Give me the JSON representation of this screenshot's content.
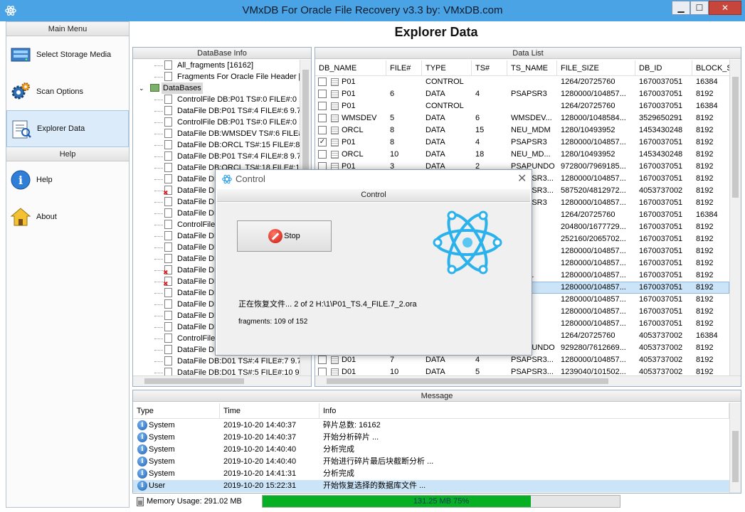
{
  "window": {
    "title": "VMxDB For Oracle File Recovery v3.3 by: VMxDB.com"
  },
  "sidebar": {
    "main_menu_header": "Main Menu",
    "help_header": "Help",
    "items": [
      {
        "label": "Select Storage Media",
        "icon": "storage-media-icon"
      },
      {
        "label": "Scan Options",
        "icon": "gear-icon"
      },
      {
        "label": "Explorer Data",
        "icon": "explorer-data-icon",
        "active": true
      }
    ],
    "help_items": [
      {
        "label": "Help",
        "icon": "info-icon"
      },
      {
        "label": "About",
        "icon": "house-icon"
      }
    ]
  },
  "main": {
    "title": "Explorer Data"
  },
  "dbinfo": {
    "header": "DataBase Info",
    "tree": [
      {
        "label": "All_fragments [16162]",
        "level": 2
      },
      {
        "label": "Fragments For Oracle File Header [5",
        "level": 2
      },
      {
        "label": "DataBases",
        "level": 1,
        "expanded": true,
        "selected": true
      },
      {
        "label": "ControlFile DB:P01 TS#:0 FILE#:0 1",
        "level": 2
      },
      {
        "label": "DataFile DB:P01 TS#:4 FILE#:6 9.7",
        "level": 2
      },
      {
        "label": "ControlFile DB:P01 TS#:0 FILE#:0 1",
        "level": 2
      },
      {
        "label": "DataFile DB:WMSDEV TS#:6 FILE#:",
        "level": 2
      },
      {
        "label": "DataFile DB:ORCL TS#:15 FILE#:8",
        "level": 2
      },
      {
        "label": "DataFile DB:P01 TS#:4 FILE#:8 9.7",
        "level": 2
      },
      {
        "label": "DataFile DB:ORCL TS#:18 FILE#:10",
        "level": 2
      },
      {
        "label": "DataFile DB",
        "level": 2
      },
      {
        "label": "DataFile DB",
        "level": 2,
        "bad": true
      },
      {
        "label": "DataFile DB",
        "level": 2
      },
      {
        "label": "DataFile DB",
        "level": 2
      },
      {
        "label": "ControlFile",
        "level": 2
      },
      {
        "label": "DataFile DB",
        "level": 2
      },
      {
        "label": "DataFile DB",
        "level": 2
      },
      {
        "label": "DataFile DB",
        "level": 2
      },
      {
        "label": "DataFile DB",
        "level": 2,
        "bad": true
      },
      {
        "label": "DataFile DB",
        "level": 2,
        "bad": true
      },
      {
        "label": "DataFile DB",
        "level": 2
      },
      {
        "label": "DataFile DB",
        "level": 2
      },
      {
        "label": "DataFile DB",
        "level": 2
      },
      {
        "label": "DataFile DB",
        "level": 2
      },
      {
        "label": "ControlFile",
        "level": 2
      },
      {
        "label": "DataFile DB",
        "level": 2
      },
      {
        "label": "DataFile DB:D01 TS#:4 FILE#:7 9.7",
        "level": 2
      },
      {
        "label": "DataFile DB:D01 TS#:5 FILE#:10 9.",
        "level": 2
      }
    ]
  },
  "datalist": {
    "header": "Data List",
    "columns": [
      "DB_NAME",
      "FILE#",
      "TYPE",
      "TS#",
      "TS_NAME",
      "FILE_SIZE",
      "DB_ID",
      "BLOCK_SI"
    ],
    "rows": [
      {
        "checked": false,
        "cells": [
          "P01",
          "",
          "CONTROL",
          "",
          "",
          "1264/20725760",
          "1670037051",
          "16384"
        ]
      },
      {
        "checked": false,
        "cells": [
          "P01",
          "6",
          "DATA",
          "4",
          "PSAPSR3",
          "1280000/104857...",
          "1670037051",
          "8192"
        ]
      },
      {
        "checked": false,
        "cells": [
          "P01",
          "",
          "CONTROL",
          "",
          "",
          "1264/20725760",
          "1670037051",
          "16384"
        ]
      },
      {
        "checked": false,
        "cells": [
          "WMSDEV",
          "5",
          "DATA",
          "6",
          "WMSDEV...",
          "128000/1048584...",
          "3529650291",
          "8192"
        ]
      },
      {
        "checked": false,
        "cells": [
          "ORCL",
          "8",
          "DATA",
          "15",
          "NEU_MDM",
          "1280/10493952",
          "1453430248",
          "8192"
        ]
      },
      {
        "checked": true,
        "cells": [
          "P01",
          "8",
          "DATA",
          "4",
          "PSAPSR3",
          "1280000/104857...",
          "1670037051",
          "8192"
        ]
      },
      {
        "checked": false,
        "cells": [
          "ORCL",
          "10",
          "DATA",
          "18",
          "NEU_MD...",
          "1280/10493952",
          "1453430248",
          "8192"
        ]
      },
      {
        "checked": false,
        "cells": [
          "P01",
          "3",
          "DATA",
          "2",
          "PSAPUNDO",
          "972800/7969185...",
          "1670037051",
          "8192"
        ]
      },
      {
        "checked": false,
        "cells": [
          "",
          "",
          "",
          "",
          "PSAPSR3...",
          "1280000/104857...",
          "1670037051",
          "8192"
        ]
      },
      {
        "checked": false,
        "cells": [
          "",
          "",
          "",
          "",
          "PSAPSR3...",
          "587520/4812972...",
          "4053737002",
          "8192"
        ]
      },
      {
        "checked": false,
        "cells": [
          "",
          "",
          "",
          "",
          "PSAPSR3",
          "1280000/104857...",
          "1670037051",
          "8192"
        ]
      },
      {
        "checked": false,
        "cells": [
          "",
          "",
          "",
          "",
          "",
          "1264/20725760",
          "1670037051",
          "16384"
        ]
      },
      {
        "checked": false,
        "cells": [
          "",
          "",
          "",
          "",
          "...IX",
          "204800/1677729...",
          "1670037051",
          "8192"
        ]
      },
      {
        "checked": false,
        "cells": [
          "",
          "",
          "",
          "",
          "...M",
          "252160/2065702...",
          "1670037051",
          "8192"
        ]
      },
      {
        "checked": false,
        "cells": [
          "",
          "",
          "",
          "",
          "...R3",
          "1280000/104857...",
          "1670037051",
          "8192"
        ]
      },
      {
        "checked": false,
        "cells": [
          "",
          "",
          "",
          "",
          "...R3",
          "1280000/104857...",
          "1670037051",
          "8192"
        ]
      },
      {
        "checked": false,
        "cells": [
          "",
          "",
          "",
          "",
          "...R3...",
          "1280000/104857...",
          "1670037051",
          "8192"
        ]
      },
      {
        "checked": false,
        "selected": true,
        "cells": [
          "",
          "",
          "",
          "",
          "...R3",
          "1280000/104857...",
          "1670037051",
          "8192"
        ]
      },
      {
        "checked": false,
        "cells": [
          "",
          "",
          "",
          "",
          "...R3",
          "1280000/104857...",
          "1670037051",
          "8192"
        ]
      },
      {
        "checked": false,
        "cells": [
          "",
          "",
          "",
          "",
          "...R3",
          "1280000/104857...",
          "1670037051",
          "8192"
        ]
      },
      {
        "checked": false,
        "cells": [
          "",
          "",
          "",
          "",
          "...R3",
          "1280000/104857...",
          "1670037051",
          "8192"
        ]
      },
      {
        "checked": false,
        "cells": [
          "",
          "",
          "",
          "",
          "",
          "1264/20725760",
          "4053737002",
          "16384"
        ]
      },
      {
        "checked": false,
        "cells": [
          "",
          "",
          "",
          "",
          "PSAPUNDO",
          "929280/7612669...",
          "4053737002",
          "8192"
        ]
      },
      {
        "checked": false,
        "cells": [
          "D01",
          "7",
          "DATA",
          "4",
          "PSAPSR3...",
          "1280000/104857...",
          "4053737002",
          "8192"
        ]
      },
      {
        "checked": false,
        "cells": [
          "D01",
          "10",
          "DATA",
          "5",
          "PSAPSR3...",
          "1239040/101502...",
          "4053737002",
          "8192"
        ]
      }
    ]
  },
  "message": {
    "header": "Message",
    "columns": [
      "Type",
      "Time",
      "Info"
    ],
    "rows": [
      {
        "type": "System",
        "time": "2019-10-20 14:40:37",
        "info": "碎片总数: 16162"
      },
      {
        "type": "System",
        "time": "2019-10-20 14:40:37",
        "info": "开始分析碎片 ..."
      },
      {
        "type": "System",
        "time": "2019-10-20 14:40:40",
        "info": "分析完成"
      },
      {
        "type": "System",
        "time": "2019-10-20 14:40:40",
        "info": "开始进行碎片最后块截断分析 ..."
      },
      {
        "type": "System",
        "time": "2019-10-20 14:41:31",
        "info": "分析完成"
      },
      {
        "type": "User",
        "time": "2019-10-20 15:22:31",
        "info": "开始恢复选择的数据库文件 ...",
        "selected": true
      }
    ]
  },
  "status": {
    "memory_usage": "Memory Usage: 291.02 MB",
    "progress_text": "131.25 MB 75%",
    "progress_fraction": 0.75
  },
  "dialog": {
    "title": "Control",
    "subheader": "Control",
    "stop_label": "Stop",
    "status_text": "正在恢复文件... 2 of 2 H:\\1\\P01_TS.4_FILE.7_2.ora",
    "fragments_text": "fragments: 109 of 152"
  },
  "colors": {
    "titlebar": "#4aa3e4",
    "progress": "#06b025",
    "selection": "#cce4f7",
    "close_button": "#c7463b"
  }
}
